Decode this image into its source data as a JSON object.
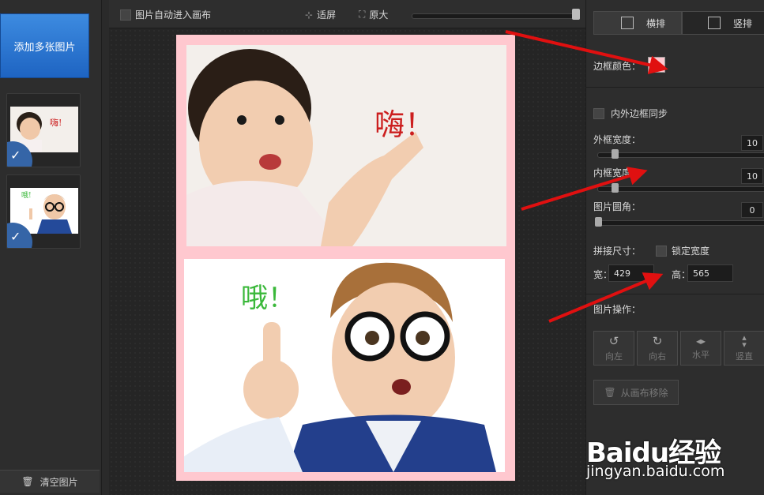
{
  "left_panel": {
    "add_button": "添加多张图片",
    "clear_button": "清空图片",
    "thumb1_text": "嗨!",
    "thumb2_text": "哦!"
  },
  "toolbar": {
    "auto_enter_canvas": "图片自动进入画布",
    "fit_screen": "适屏",
    "original_size": "原大"
  },
  "canvas": {
    "photo1_caption": "嗨！",
    "photo2_caption": "哦！",
    "border_color": "#ffc8cf"
  },
  "right_panel": {
    "tab_horizontal": "横排",
    "tab_vertical": "竖排",
    "border_color_label": "边框颜色：",
    "sync_borders_label": "内外边框同步",
    "outer_width_label": "外框宽度：",
    "outer_width_value": "10",
    "inner_width_label": "内框宽度",
    "inner_width_value": "10",
    "corner_radius_label": "图片圆角：",
    "corner_radius_value": "0",
    "size_label": "拼接尺寸：",
    "lock_width_label": "锁定宽度",
    "width_label": "宽：",
    "width_value": "429",
    "height_label": "高：",
    "height_value": "565",
    "ops_label": "图片操作：",
    "rotate_left": "向左",
    "rotate_right": "向右",
    "flip_horizontal": "水平",
    "flip_vertical": "竖直",
    "remove_from_canvas": "从画布移除"
  },
  "watermark": {
    "brand": "Baidu经验",
    "url": "jingyan.baidu.com"
  }
}
